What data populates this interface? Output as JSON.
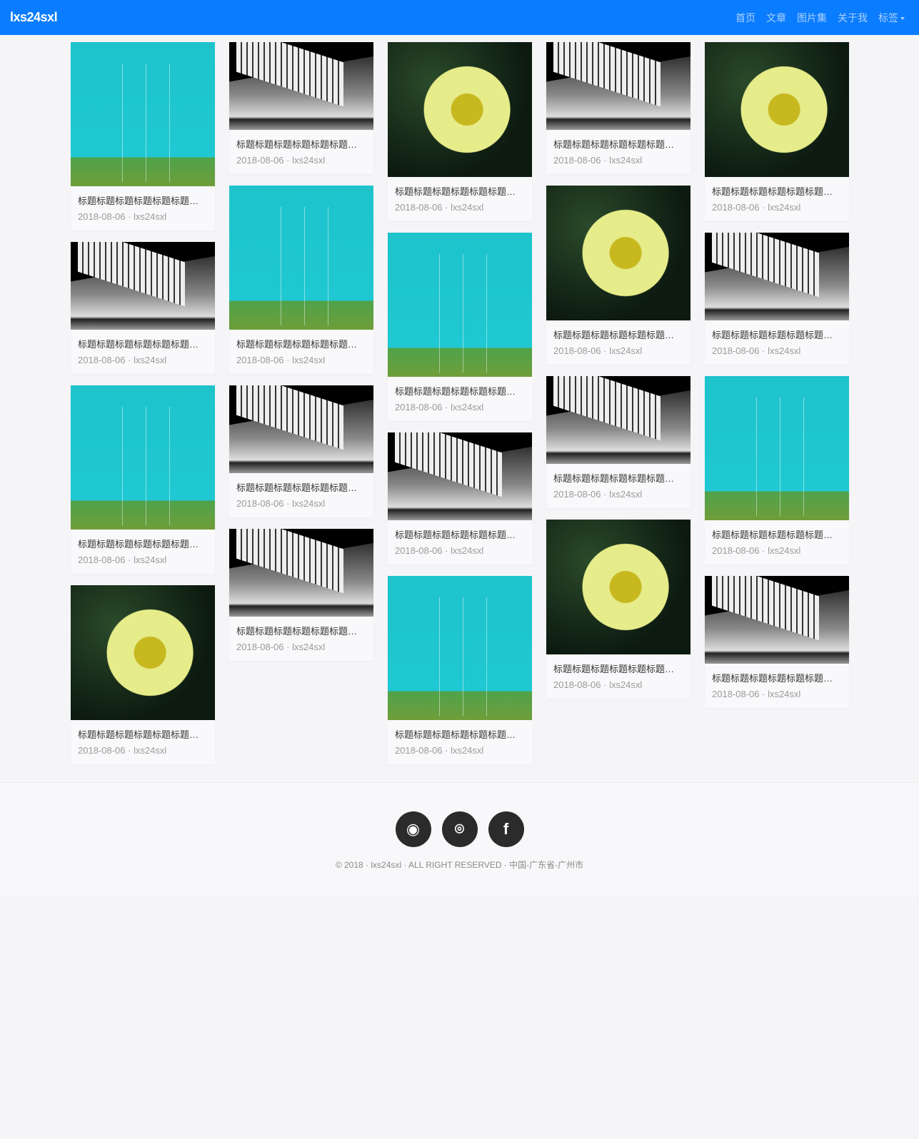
{
  "nav": {
    "brand": "lxs24sxl",
    "items": [
      "首页",
      "文章",
      "图片集",
      "关于我"
    ],
    "dropdown": "标签"
  },
  "columns": [
    [
      {
        "type": "teal"
      },
      {
        "type": "fence"
      },
      {
        "type": "teal"
      },
      {
        "type": "flower"
      }
    ],
    [
      {
        "type": "fence"
      },
      {
        "type": "teal"
      },
      {
        "type": "fence"
      },
      {
        "type": "fence"
      }
    ],
    [
      {
        "type": "flower"
      },
      {
        "type": "teal"
      },
      {
        "type": "fence"
      },
      {
        "type": "teal"
      }
    ],
    [
      {
        "type": "fence"
      },
      {
        "type": "flower"
      },
      {
        "type": "fence"
      },
      {
        "type": "flower"
      }
    ],
    [
      {
        "type": "flower"
      },
      {
        "type": "fence"
      },
      {
        "type": "teal"
      },
      {
        "type": "fence"
      }
    ]
  ],
  "card": {
    "title": "标题标题标题标题标题标题标题标题",
    "date": "2018-08-06",
    "author": "lxs24sxl"
  },
  "footer": {
    "icons": [
      "weibo",
      "github",
      "facebook"
    ],
    "copyright": "© 2018 · lxs24sxl · ALL RIGHT RESERVED · 中国-广东省-广州市"
  }
}
